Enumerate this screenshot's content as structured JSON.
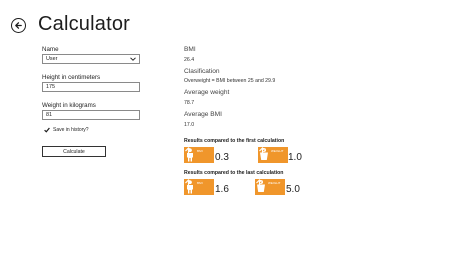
{
  "app": {
    "title": "Calculator"
  },
  "form": {
    "name_label": "Name",
    "name_value": "User",
    "height_label": "Height in centimeters",
    "height_value": "175",
    "weight_label": "Weight in kilograms",
    "weight_value": "81",
    "save_label": "Save in history?",
    "save_checked": true,
    "calculate_label": "Calculate"
  },
  "results": {
    "bmi_label": "BMI",
    "bmi_value": "26.4",
    "classification_label": "Clasification",
    "classification_value": "Overweight = BMI between 25 and 29.9",
    "avg_weight_label": "Average weight",
    "avg_weight_value": "78.7",
    "avg_bmi_label": "Average BMI",
    "avg_bmi_value": "17.0"
  },
  "comparisons": {
    "first": {
      "heading": "Results compared to the first calculation",
      "bmi_tile_text": "BMI",
      "bmi_value": "0.3",
      "weight_tile_text": "WEIGHT",
      "weight_value": "1.0"
    },
    "last": {
      "heading": "Results compared to the last calculation",
      "bmi_tile_text": "BMI",
      "bmi_value": "1.6",
      "weight_tile_text": "WEIGHT",
      "weight_value": "5.0"
    }
  },
  "icons": {
    "back": "back-arrow-icon",
    "dropdown": "chevron-down-icon",
    "check": "checkmark-icon",
    "person": "person-icon",
    "scale": "weight-scale-icon",
    "up": "arrow-up-icon"
  },
  "colors": {
    "tile": "#f0962b",
    "text": "#1d1d1d",
    "background": "#ffffff"
  }
}
